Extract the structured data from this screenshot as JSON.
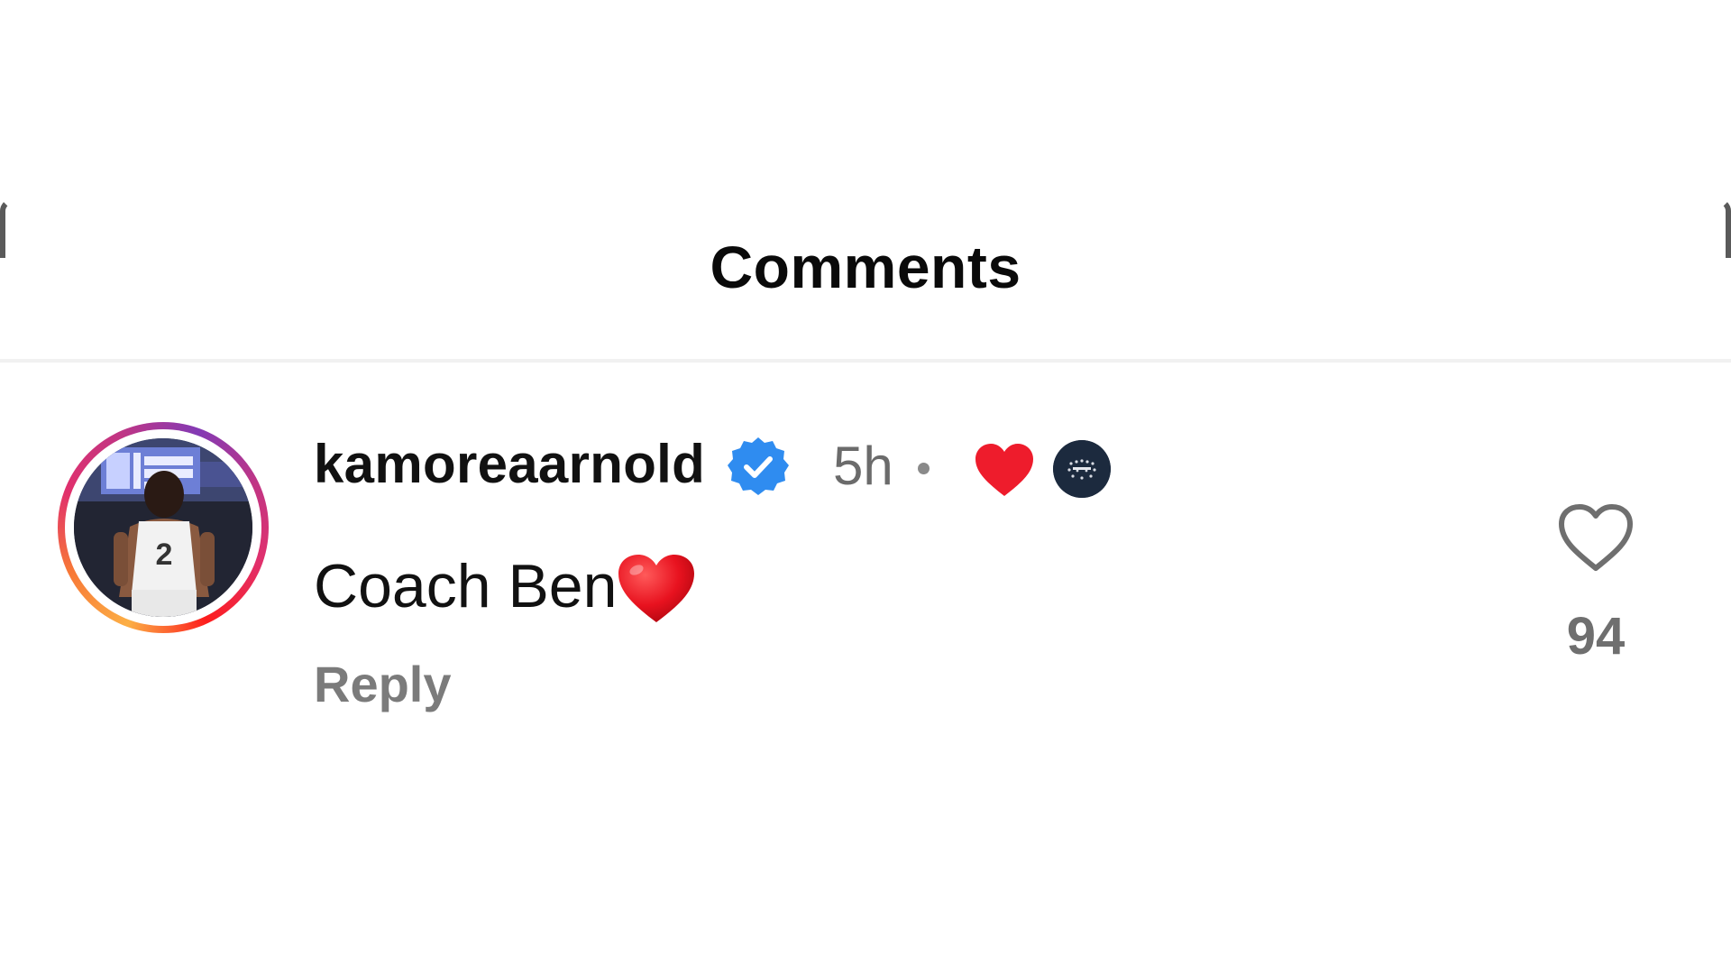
{
  "sheet": {
    "title": "Comments"
  },
  "comment": {
    "username": "kamoreaarnold",
    "verified": true,
    "timestamp": "5h",
    "separator": "•",
    "liked_by_author_icon": "heart-icon",
    "text": "Coach Ben",
    "text_emoji": "red-heart-emoji",
    "reply_label": "Reply",
    "like_count": "94"
  },
  "colors": {
    "verified_badge": "#2f8cf0",
    "heart_red": "#ee1c2c",
    "muted_text": "#737373",
    "author_avatar_bg": "#1c2a3e"
  }
}
